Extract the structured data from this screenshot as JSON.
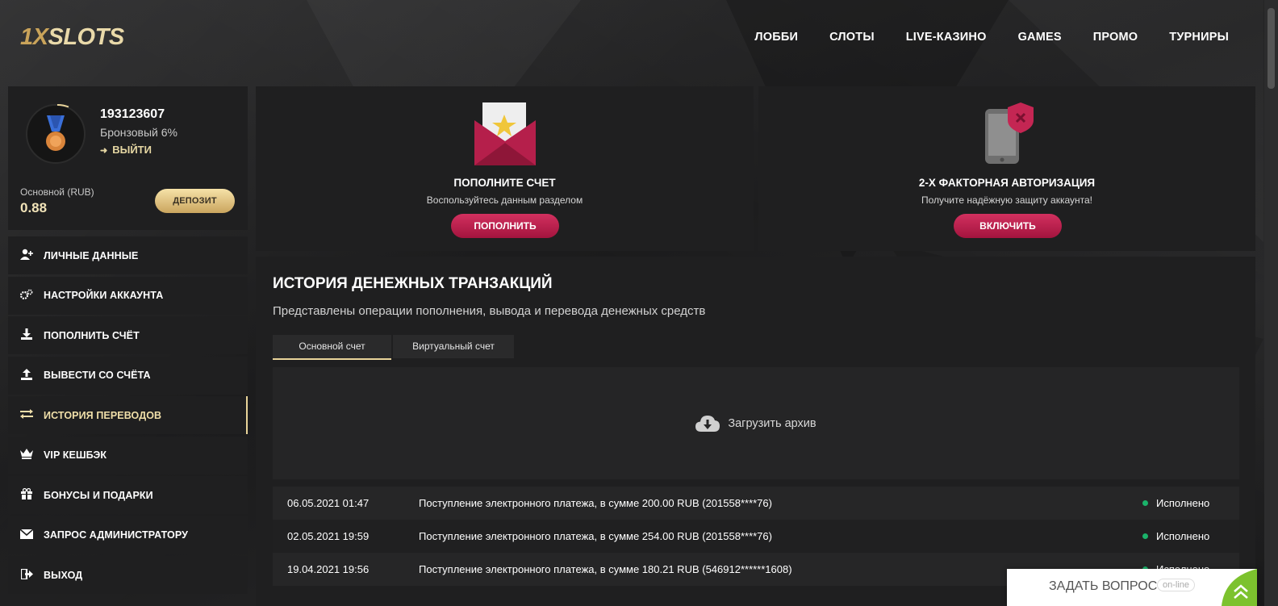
{
  "header": {
    "logo": {
      "part1": "1X",
      "part2": "SLOTS"
    },
    "nav": [
      "ЛОББИ",
      "СЛОТЫ",
      "LIVE-КАЗИНО",
      "GAMES",
      "ПРОМО",
      "ТУРНИРЫ"
    ]
  },
  "profile": {
    "user_id": "193123607",
    "level": "Бронзовый 6%",
    "logout_label": "ВЫЙТИ",
    "balance_label": "Основной (RUB)",
    "balance_value": "0.88",
    "deposit_label": "ДЕПОЗИТ"
  },
  "menu": [
    {
      "label": "ЛИЧНЫЕ ДАННЫЕ",
      "icon": "user-plus-icon",
      "active": false
    },
    {
      "label": "НАСТРОЙКИ АККАУНТА",
      "icon": "gears-icon",
      "active": false
    },
    {
      "label": "ПОПОЛНИТЬ СЧЁТ",
      "icon": "download-icon",
      "active": false
    },
    {
      "label": "ВЫВЕСТИ СО СЧЁТА",
      "icon": "upload-icon",
      "active": false
    },
    {
      "label": "ИСТОРИЯ ПЕРЕВОДОВ",
      "icon": "transfer-arrows-icon",
      "active": true
    },
    {
      "label": "VIP КЕШБЭК",
      "icon": "crown-icon",
      "active": false
    },
    {
      "label": "БОНУСЫ И ПОДАРКИ",
      "icon": "gift-icon",
      "active": false
    },
    {
      "label": "ЗАПРОС АДМИНИСТРАТОРУ",
      "icon": "envelope-icon",
      "active": false
    },
    {
      "label": "ВЫХОД",
      "icon": "sign-out-icon",
      "active": false
    }
  ],
  "cards": {
    "deposit": {
      "title": "ПОПОЛНИТЕ СЧЕТ",
      "subtitle": "Воспользуйтесь данным разделом",
      "button": "ПОПОЛНИТЬ"
    },
    "twofa": {
      "title": "2-Х ФАКТОРНАЯ АВТОРИЗАЦИЯ",
      "subtitle": "Получите надёжную защиту аккаунта!",
      "button": "ВКЛЮЧИТЬ"
    }
  },
  "history": {
    "title": "ИСТОРИЯ ДЕНЕЖНЫХ ТРАНЗАКЦИЙ",
    "subtitle": "Представлены операции пополнения, вывода и перевода денежных средств",
    "tabs": [
      "Основной счет",
      "Виртуальный счет"
    ],
    "archive_label": "Загрузить архив",
    "rows": [
      {
        "date": "06.05.2021 01:47",
        "desc": "Поступление электронного платежа, в сумме 200.00 RUB (201558****76)",
        "status": "Исполнено"
      },
      {
        "date": "02.05.2021 19:59",
        "desc": "Поступление электронного платежа, в сумме 254.00 RUB (201558****76)",
        "status": "Исполнено"
      },
      {
        "date": "19.04.2021 19:56",
        "desc": "Поступление электронного платежа, в сумме 180.21 RUB (546912******1608)",
        "status": "Исполнено"
      }
    ]
  },
  "chat": {
    "label": "ЗАДАТЬ ВОПРОС",
    "status": "on-line"
  },
  "colors": {
    "accent_gold": "#e9d49a",
    "button_red": "#c1264f",
    "status_green": "#1ab36a"
  }
}
